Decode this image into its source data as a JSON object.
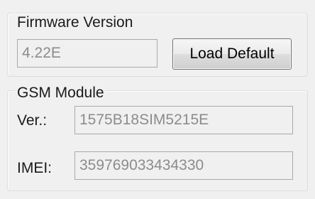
{
  "firmware": {
    "title": "Firmware Version",
    "version_value": "4.22E",
    "load_default_label": "Load Default"
  },
  "gsm": {
    "title": "GSM Module",
    "ver_label": "Ver.:",
    "ver_value": "1575B18SIM5215E",
    "imei_label": "IMEI:",
    "imei_value": "359769033434330"
  }
}
